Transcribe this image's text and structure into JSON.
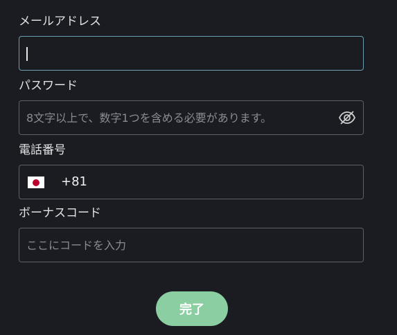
{
  "email": {
    "label": "メールアドレス",
    "value": "",
    "placeholder": ""
  },
  "password": {
    "label": "パスワード",
    "value": "",
    "placeholder": "8文字以上で、数字1つを含める必要があります。",
    "toggle_icon": "eye-off-icon"
  },
  "phone": {
    "label": "電話番号",
    "country_flag": "japan-flag",
    "dial_code": "+81",
    "value": ""
  },
  "bonus_code": {
    "label": "ボーナスコード",
    "value": "",
    "placeholder": "ここにコードを入力"
  },
  "submit": {
    "label": "完了",
    "color": "#8bcea2"
  },
  "colors": {
    "background": "#1a1c22",
    "focus_border": "#6e9fb3",
    "border": "#5c5f68"
  }
}
